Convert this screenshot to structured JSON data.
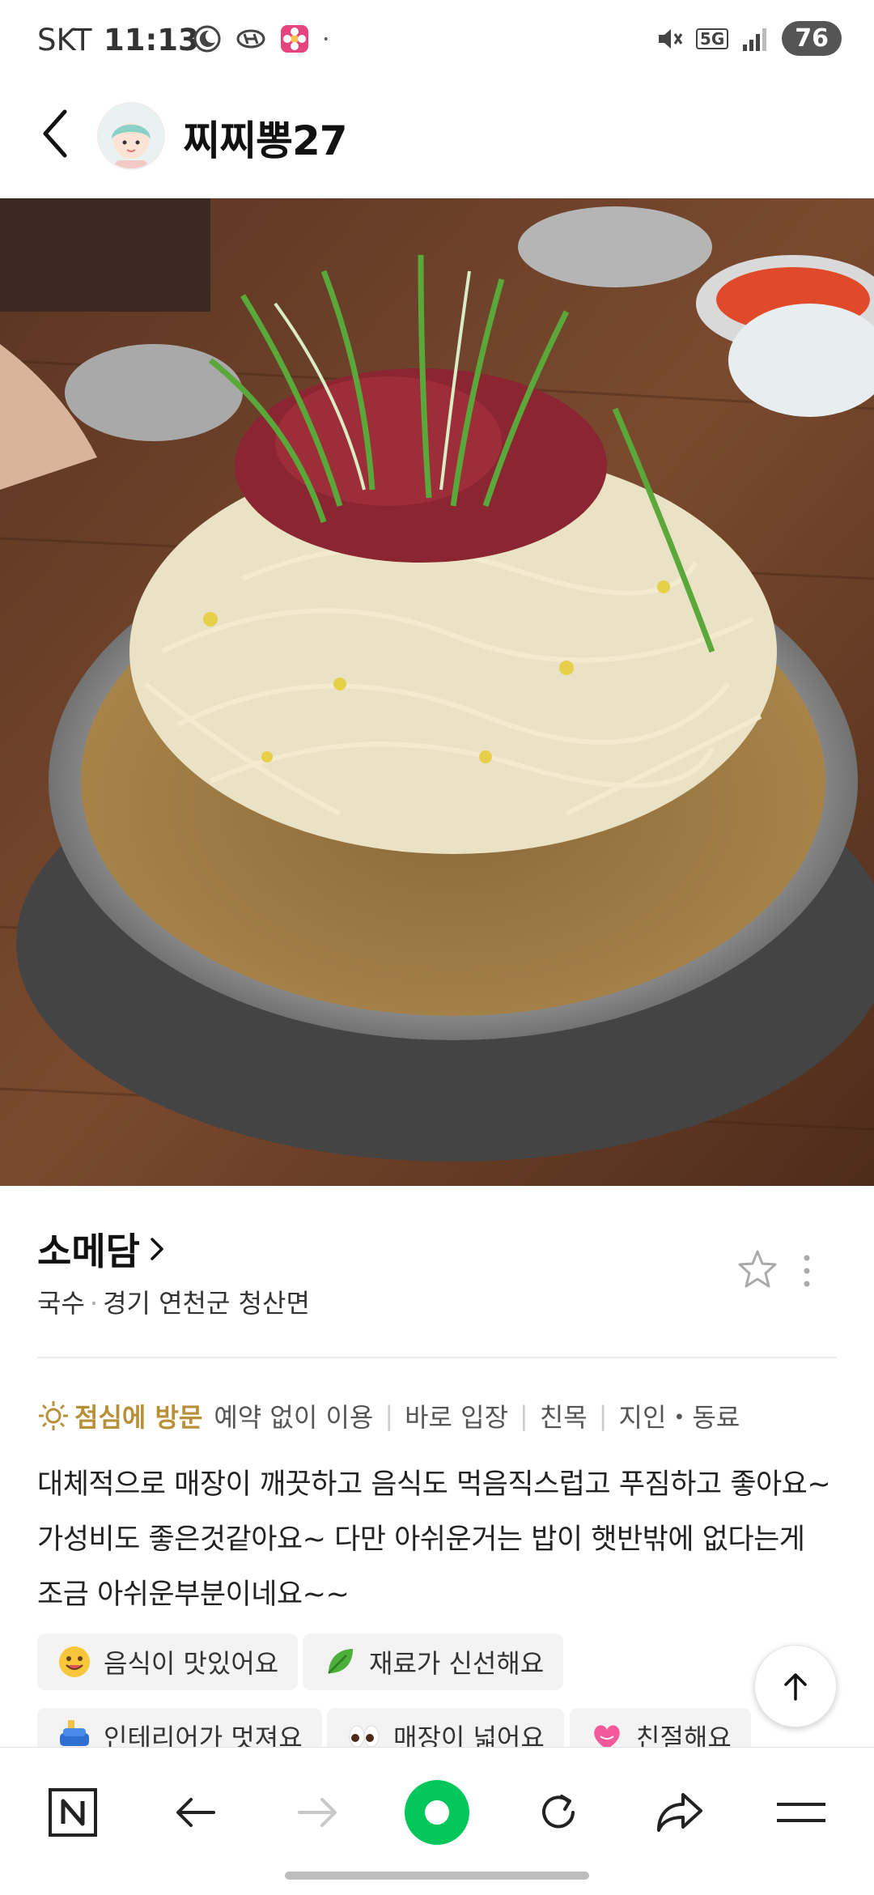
{
  "status_bar": {
    "carrier": "SKT",
    "time": "11:13",
    "network": "5G",
    "battery": "76"
  },
  "header": {
    "username": "찌찌뽕27"
  },
  "place": {
    "name": "소메담",
    "category": "국수",
    "location": "경기 연천군 청산면"
  },
  "visit": {
    "highlight": "점심에 방문",
    "tags": [
      "예약 없이 이용",
      "바로 입장",
      "친목",
      "지인・동료"
    ]
  },
  "review": {
    "text": "대체적으로 매장이 깨끗하고 음식도 먹음직스럽고 푸짐하고 좋아요~ 가성비도 좋은것같아요~ 다만 아쉬운거는 밥이 햇반밖에 없다는게 조금 아쉬운부분이네요~~"
  },
  "keywords": [
    {
      "label": "음식이 맛있어요",
      "icon": "smiley-icon"
    },
    {
      "label": "재료가 신선해요",
      "icon": "leaf-icon"
    },
    {
      "label": "인테리어가 멋져요",
      "icon": "sofa-icon"
    },
    {
      "label": "매장이 넓어요",
      "icon": "eyes-icon"
    },
    {
      "label": "친절해요",
      "icon": "heart-icon"
    }
  ],
  "colors": {
    "visit_highlight": "#b8903a",
    "nav_active": "#03c75a"
  }
}
